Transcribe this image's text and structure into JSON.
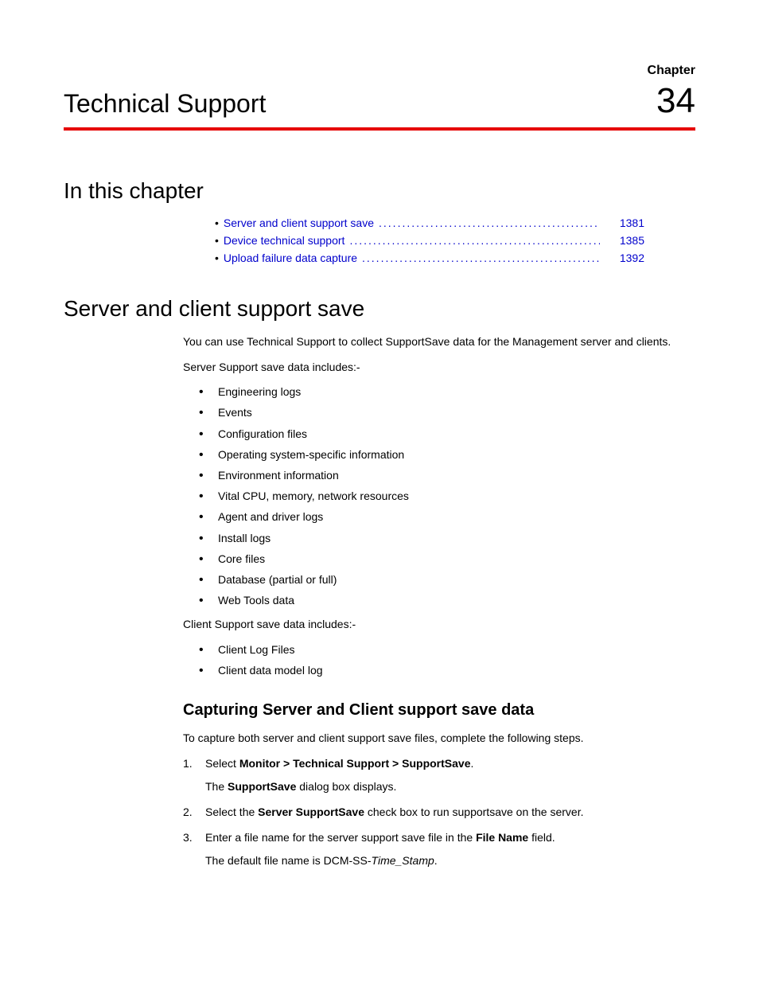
{
  "chapter": {
    "label": "Chapter",
    "title": "Technical Support",
    "number": "34"
  },
  "toc": {
    "heading": "In this chapter",
    "items": [
      {
        "label": "Server and client support save",
        "page": "1381"
      },
      {
        "label": "Device technical support",
        "page": "1385"
      },
      {
        "label": "Upload failure data capture",
        "page": "1392"
      }
    ]
  },
  "section1": {
    "heading": "Server and client support save",
    "intro": "You can use Technical Support to collect SupportSave data for the Management server and clients.",
    "server_label": "Server Support save data includes:-",
    "server_items": [
      "Engineering logs",
      "Events",
      "Configuration files",
      "Operating system-specific information",
      "Environment information",
      "Vital CPU, memory, network resources",
      "Agent and driver logs",
      "Install logs",
      "Core files",
      "Database (partial or full)",
      "Web Tools data"
    ],
    "client_label": "Client Support save data includes:-",
    "client_items": [
      "Client Log Files",
      "Client data model log"
    ]
  },
  "subsection": {
    "heading": "Capturing Server and Client support save data",
    "intro": "To capture both server and client support save files, complete the following steps.",
    "steps": {
      "s1_prefix": "Select ",
      "s1_bold": "Monitor > Technical Support > SupportSave",
      "s1_suffix": ".",
      "s1_sub_prefix": "The ",
      "s1_sub_bold": "SupportSave",
      "s1_sub_suffix": " dialog box displays.",
      "s2_prefix": "Select the ",
      "s2_bold": "Server SupportSave",
      "s2_suffix": " check box to run supportsave on the server.",
      "s3_prefix": "Enter a file name for the server support save file in the ",
      "s3_bold": "File Name",
      "s3_suffix": " field.",
      "s3_sub_prefix": "The default file name is DCM-SS-",
      "s3_sub_italic": "Time_Stamp",
      "s3_sub_suffix": "."
    }
  }
}
